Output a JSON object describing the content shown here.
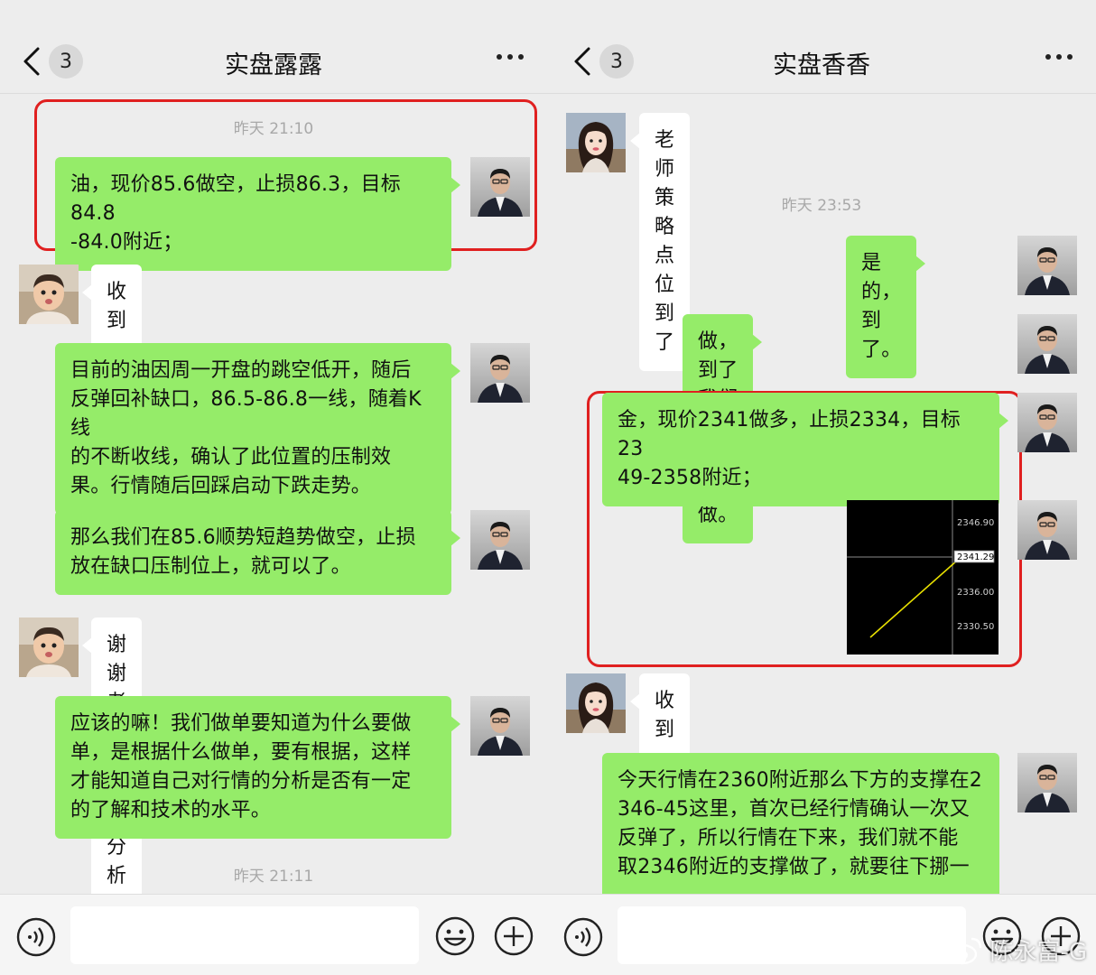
{
  "left_chat": {
    "unread_count": "3",
    "title": "实盘露露",
    "timestamps": [
      "昨天 21:10",
      "昨天 21:11"
    ],
    "messages": [
      {
        "side": "right",
        "text": "油，现价85.6做空，止损86.3，目标84.8\n-84.0附近；"
      },
      {
        "side": "left",
        "text": "收到"
      },
      {
        "side": "right",
        "text": "目前的油因周一开盘的跳空低开，随后\n反弹回补缺口，86.5-86.8一线，随着K线\n的不断收线，确认了此位置的压制效\n果。行情随后回踩启动下跌走势。"
      },
      {
        "side": "right",
        "text": "那么我们在85.6顺势短趋势做空，止损\n放在缺口压制位上，就可以了。"
      },
      {
        "side": "left",
        "text": "谢谢老师的精细分析"
      },
      {
        "side": "right",
        "text": "应该的嘛！我们做单要知道为什么要做\n单，是根据什么做单，要有根据，这样\n才能知道自己对行情的分析是否有一定\n的了解和技术的水平。"
      }
    ]
  },
  "right_chat": {
    "unread_count": "3",
    "title": "实盘香香",
    "timestamps": [
      "昨天 23:53"
    ],
    "messages": [
      {
        "side": "left",
        "text": "老师策略点位到了"
      },
      {
        "side": "right",
        "text": "是的，到了。"
      },
      {
        "side": "right",
        "text": "做，到了我们研判的位置就做。"
      },
      {
        "side": "right",
        "text": "金，现价2341做多，止损2334，目标23\n49-2358附近；"
      },
      {
        "side": "right",
        "type": "image"
      },
      {
        "side": "left",
        "text": "收到"
      },
      {
        "side": "right",
        "text": "今天行情在2360附近那么下方的支撑在2\n346-45这里，首次已经行情确认一次又\n反弹了，所以行情在下来，我们就不能\n取2346附近的支撑做了，就要往下挪一"
      }
    ]
  },
  "price_chart": {
    "axis_labels": [
      "2346.90",
      "2341.29",
      "2336.00",
      "2330.50"
    ],
    "current_price": "2341.29"
  },
  "watermark": "陈永富-G",
  "colors": {
    "my_bubble": "#95ec69",
    "their_bubble": "#ffffff",
    "background": "#ededed",
    "highlight": "#e02020"
  },
  "icons": [
    "chevron-left-icon",
    "more-dots-icon",
    "voice-icon",
    "emoji-icon",
    "plus-icon",
    "weibo-icon"
  ]
}
